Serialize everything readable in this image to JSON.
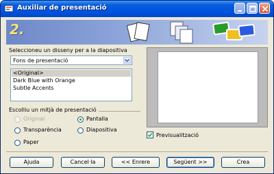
{
  "window": {
    "title": "Auxiliar de presentació"
  },
  "banner": {
    "step": "2."
  },
  "design": {
    "label": "Seleccioneu un disseny per a la diapositiva",
    "selected": "Fons de presentació",
    "list": [
      "<Original>",
      "Dark Blue with Orange",
      "Subtle Accents"
    ]
  },
  "medium": {
    "label": "Escolliu un mitjà de presentació",
    "options": [
      {
        "label": "Original",
        "checked": false,
        "disabled": true
      },
      {
        "label": "Pantalla",
        "checked": true,
        "disabled": false
      },
      {
        "label": "Transparència",
        "checked": false,
        "disabled": false
      },
      {
        "label": "Diapositiva",
        "checked": false,
        "disabled": false
      },
      {
        "label": "Paper",
        "checked": false,
        "disabled": false
      }
    ]
  },
  "preview": {
    "label": "Previsualització",
    "checked": true
  },
  "buttons": {
    "help": "Ajuda",
    "cancel": "Cancel·la",
    "back": "<< Enrere",
    "next": "Següent >>",
    "create": "Crea"
  },
  "colors": {
    "titlebar": "#0054e3",
    "window_bg": "#ece9d8",
    "banner": "#8aa2d8",
    "accent": "#21a121"
  }
}
